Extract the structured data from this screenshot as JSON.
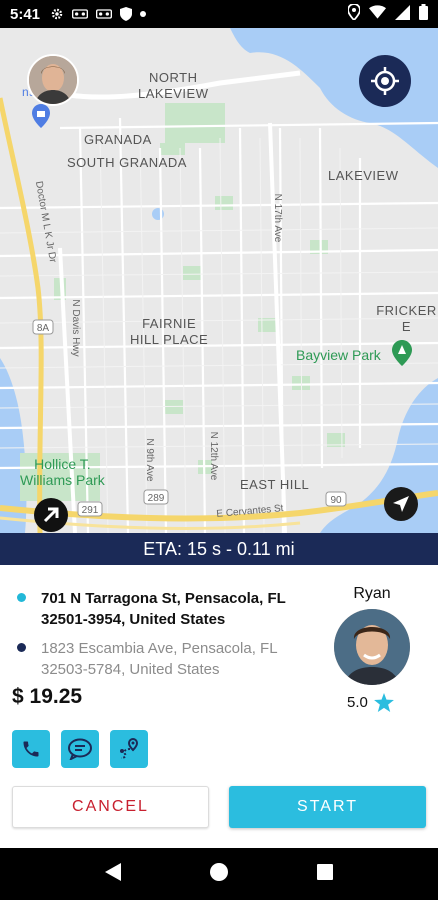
{
  "status_bar": {
    "time": "5:41",
    "icons_left": [
      "settings-icon",
      "voicemail-icon",
      "voicemail-icon",
      "shield-icon",
      "dot-icon"
    ],
    "icons_right": [
      "location-icon",
      "wifi-icon",
      "signal-icon",
      "battery-icon"
    ]
  },
  "map": {
    "labels": {
      "north_lakeview": "NORTH\nLAKEVIEW",
      "granada": "GRANADA",
      "south_granada": "SOUTH GRANADA",
      "lakeview": "LAKEVIEW",
      "fairnie": "FAIRNIE\nHILL PLACE",
      "fricker": "FRICKER E",
      "bayview_park": "Bayview Park",
      "hollice": "Hollice T.\nWilliams Park",
      "east_hill": "EAST HILL",
      "pensacola_partial": "nsac",
      "n17th": "N 17th Ave",
      "n12th": "N 12th Ave",
      "n9th": "N 9th Ave",
      "ndavis": "N Davis Hwy",
      "mlk": "Doctor M L K Jr Dr",
      "cervantes": "E Cervantes St",
      "route_8a": "8A",
      "route_289": "289",
      "route_291": "291",
      "route_90": "90"
    }
  },
  "eta": "ETA: 15 s - 0.11 mi",
  "trip": {
    "pickup_address": "701 N Tarragona St, Pensacola, FL 32501-3954, United States",
    "dropoff_address": "1823 Escambia Ave, Pensacola, FL 32503-5784, United States",
    "price": "$ 19.25"
  },
  "rider": {
    "name": "Ryan",
    "rating": "5.0"
  },
  "buttons": {
    "cancel": "CANCEL",
    "start": "START"
  },
  "colors": {
    "navy": "#1b2a57",
    "accent": "#2bbddf",
    "cancel_red": "#c8202f"
  }
}
